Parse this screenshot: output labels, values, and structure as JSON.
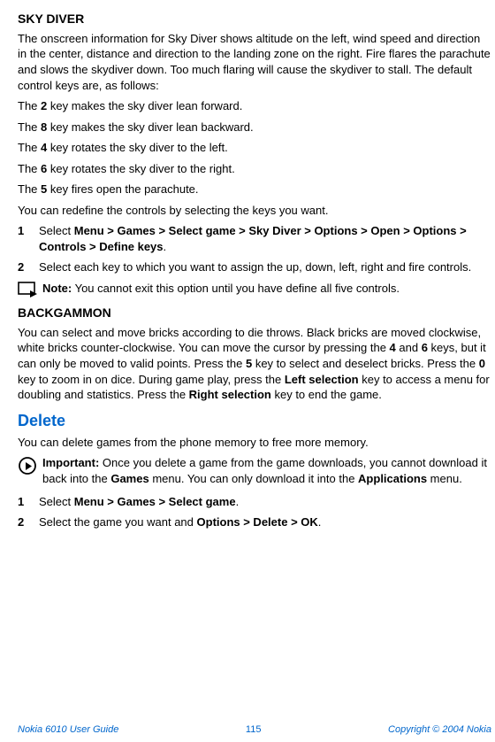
{
  "sky": {
    "heading": "SKY DIVER",
    "intro": "The onscreen information for Sky Diver shows altitude on the left, wind speed and direction in the center, distance and direction to the landing zone on the right. Fire flares the parachute and slows the skydiver down. Too much flaring will cause the skydiver to stall. The default control keys are, as follows:",
    "k2a": "The ",
    "k2b": "2",
    "k2c": " key makes the sky diver lean forward.",
    "k8a": "The ",
    "k8b": "8",
    "k8c": " key makes the sky diver lean backward.",
    "k4a": "The ",
    "k4b": "4",
    "k4c": " key rotates the sky diver to the left.",
    "k6a": "The ",
    "k6b": "6",
    "k6c": " key rotates the sky diver to the right.",
    "k5a": "The ",
    "k5b": "5",
    "k5c": " key fires open the parachute.",
    "redefine": "You can redefine the controls by selecting the keys you want.",
    "step1a": "Select ",
    "step1b": "Menu > Games > Select game > Sky Diver > Options > Open > Options > Controls > Define keys",
    "step1c": ".",
    "step2": "Select each key to which you want to assign the up, down, left, right and fire controls.",
    "noteLabel": "Note:",
    "noteText": " You cannot exit this option until you have define all five controls."
  },
  "bg": {
    "heading": "BACKGAMMON",
    "p1": "You can select and move bricks according to die throws. Black bricks are moved clockwise, white bricks counter-clockwise. You can move the cursor by pressing the ",
    "k4": "4",
    "and": " and ",
    "k6": "6",
    "p2": " keys, but it can only be moved to valid points. Press the ",
    "k5": "5",
    "p3": " key to select and deselect bricks. Press the ",
    "k0": "0",
    "p4": " key to zoom in on dice. During game play, press the ",
    "ls": "Left selection",
    "p5": " key to access a menu for doubling and statistics. Press the ",
    "rs": "Right selection",
    "p6": " key to end the game."
  },
  "del": {
    "heading": "Delete",
    "intro": "You can delete games from the phone memory to free more memory.",
    "impLabel": "Important:",
    "imp1": " Once you delete a game from the game downloads, you cannot download it back into the ",
    "impGames": "Games",
    "imp2": " menu. You can only download it into the ",
    "impApps": "Applications",
    "imp3": " menu.",
    "s1a": "Select ",
    "s1b": "Menu > Games > Select game",
    "s1c": ".",
    "s2a": "Select the game you want and ",
    "s2b": "Options > Delete > OK",
    "s2c": "."
  },
  "footer": {
    "left": "Nokia 6010 User Guide",
    "center": "115",
    "right": "Copyright © 2004 Nokia"
  },
  "nums": {
    "one": "1",
    "two": "2"
  }
}
